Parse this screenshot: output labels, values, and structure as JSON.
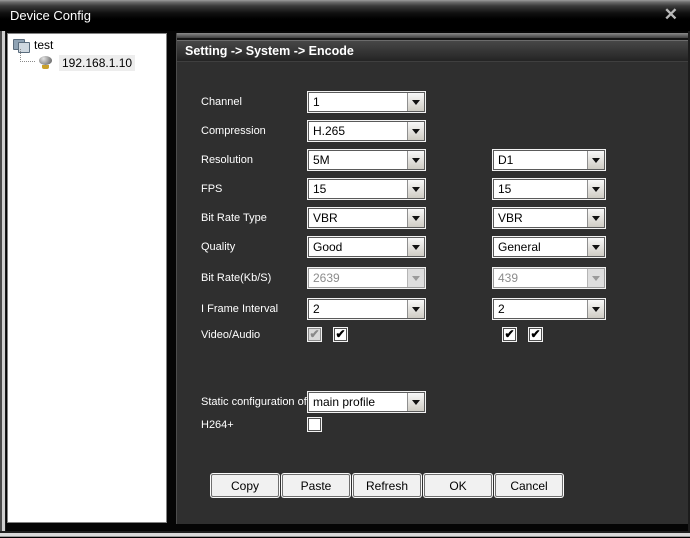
{
  "window": {
    "title": "Device Config"
  },
  "icons": {
    "close": "✕",
    "check": "✔"
  },
  "tree": {
    "root_label": "test",
    "device_label": "192.168.1.10"
  },
  "panel": {
    "header": "Setting -> System -> Encode",
    "rows": [
      {
        "label": "Channel",
        "main": "1"
      },
      {
        "label": "Compression",
        "main": "H.265"
      },
      {
        "label": "Resolution",
        "main": "5M",
        "extra": "D1"
      },
      {
        "label": "FPS",
        "main": "15",
        "extra": "15"
      },
      {
        "label": "Bit Rate Type",
        "main": "VBR",
        "extra": "VBR"
      },
      {
        "label": "Quality",
        "main": "Good",
        "extra": "General"
      },
      {
        "label": "Bit Rate(Kb/S)",
        "main": "2639",
        "extra": "439",
        "disabled": true
      },
      {
        "label": "I Frame Interval",
        "main": "2",
        "extra": "2"
      }
    ],
    "video_audio": {
      "label": "Video/Audio",
      "main": {
        "video_checked": true,
        "video_disabled": true,
        "audio_checked": true
      },
      "extra": {
        "video_checked": true,
        "audio_checked": true
      }
    },
    "static_config": {
      "label": "Static configuration of",
      "value": "main profile"
    },
    "h264": {
      "label": "H264+",
      "checked": false
    },
    "buttons": {
      "copy": "Copy",
      "paste": "Paste",
      "refresh": "Refresh",
      "ok": "OK",
      "cancel": "Cancel"
    }
  },
  "colors": {
    "panel_bg": "#2f2f2f",
    "titlebar_bg": "#000000",
    "label_text": "#ffffff",
    "disabled_text": "#8c8c8c",
    "selection_bg": "#ededed",
    "camera_base": "#c9a02a"
  }
}
